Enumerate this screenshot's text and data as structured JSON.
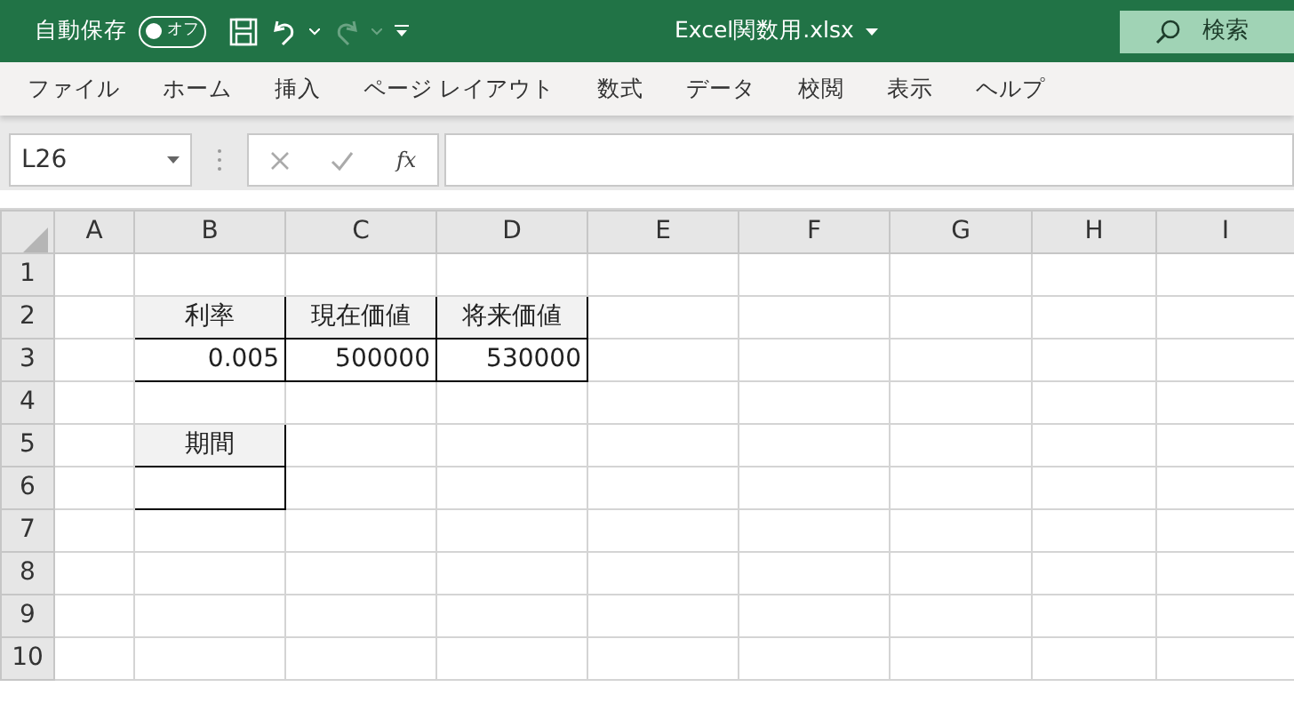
{
  "title_bar": {
    "autosave_label": "自動保存",
    "autosave_toggle": {
      "label": "オフ",
      "on": false
    },
    "redo_disabled": true,
    "filename": "Excel関数用.xlsx",
    "search_label": "検索"
  },
  "ribbon_tabs": [
    "ファイル",
    "ホーム",
    "挿入",
    "ページ レイアウト",
    "数式",
    "データ",
    "校閲",
    "表示",
    "ヘルプ"
  ],
  "formula_bar": {
    "name_box": "L26",
    "fx_label": "fx"
  },
  "columns": [
    "A",
    "B",
    "C",
    "D",
    "E",
    "F",
    "G",
    "H",
    "I"
  ],
  "rows": [
    {
      "label": "1",
      "cells": []
    },
    {
      "label": "2",
      "cells": [
        {
          "kind": "blank"
        },
        {
          "kind": "heading",
          "text": "利率"
        },
        {
          "kind": "heading",
          "text": "現在価値"
        },
        {
          "kind": "heading",
          "text": "将来価値"
        }
      ]
    },
    {
      "label": "3",
      "cells": [
        {
          "kind": "blank"
        },
        {
          "kind": "number",
          "text": "0.005"
        },
        {
          "kind": "number",
          "text": "500000"
        },
        {
          "kind": "number",
          "text": "530000"
        }
      ]
    },
    {
      "label": "4",
      "cells": []
    },
    {
      "label": "5",
      "cells": [
        {
          "kind": "blank"
        },
        {
          "kind": "heading",
          "text": "期間"
        }
      ]
    },
    {
      "label": "6",
      "cells": [
        {
          "kind": "blank"
        },
        {
          "kind": "input"
        }
      ]
    },
    {
      "label": "7",
      "cells": []
    },
    {
      "label": "8",
      "cells": []
    },
    {
      "label": "9",
      "cells": []
    },
    {
      "label": "10",
      "cells": []
    }
  ]
}
